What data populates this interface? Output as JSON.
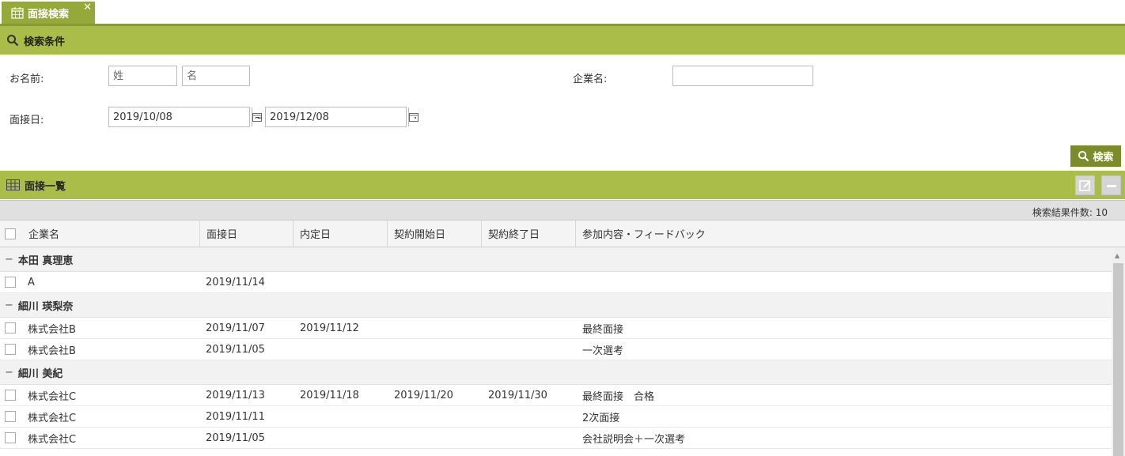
{
  "tab": {
    "label": "面接検索",
    "close": "✕"
  },
  "search_section": {
    "title": "検索条件"
  },
  "form": {
    "name_label": "お名前:",
    "last_name_placeholder": "姓",
    "first_name_placeholder": "名",
    "company_label": "企業名:",
    "company_value": "",
    "date_label": "面接日:",
    "date_from": "2019/10/08",
    "date_to": "2019/12/08",
    "tilde": "~",
    "search_button": "検索"
  },
  "list_section": {
    "title": "面接一覧"
  },
  "result_count": "検索結果件数: 10",
  "columns": [
    "企業名",
    "面接日",
    "内定日",
    "契約開始日",
    "契約終了日",
    "参加内容・フィードバック"
  ],
  "groups": [
    {
      "name": "本田 真理恵",
      "toggle": "−",
      "rows": [
        {
          "company": "A",
          "interview": "2019/11/14",
          "offer": "",
          "start": "",
          "end": "",
          "feedback": ""
        }
      ]
    },
    {
      "name": "細川 瑛梨奈",
      "toggle": "−",
      "rows": [
        {
          "company": "株式会社B",
          "interview": "2019/11/07",
          "offer": "2019/11/12",
          "start": "",
          "end": "",
          "feedback": "最終面接"
        },
        {
          "company": "株式会社B",
          "interview": "2019/11/05",
          "offer": "",
          "start": "",
          "end": "",
          "feedback": "一次選考"
        }
      ]
    },
    {
      "name": "細川 美紀",
      "toggle": "−",
      "rows": [
        {
          "company": "株式会社C",
          "interview": "2019/11/13",
          "offer": "2019/11/18",
          "start": "2019/11/20",
          "end": "2019/11/30",
          "feedback": "最終面接　合格"
        },
        {
          "company": "株式会社C",
          "interview": "2019/11/11",
          "offer": "",
          "start": "",
          "end": "",
          "feedback": "2次面接"
        },
        {
          "company": "株式会社C",
          "interview": "2019/11/05",
          "offer": "",
          "start": "",
          "end": "",
          "feedback": "会社説明会＋一次選考"
        }
      ]
    }
  ],
  "colors": {
    "accent": "#aabd48",
    "tab": "#95a93a",
    "button": "#7c8c2a"
  }
}
